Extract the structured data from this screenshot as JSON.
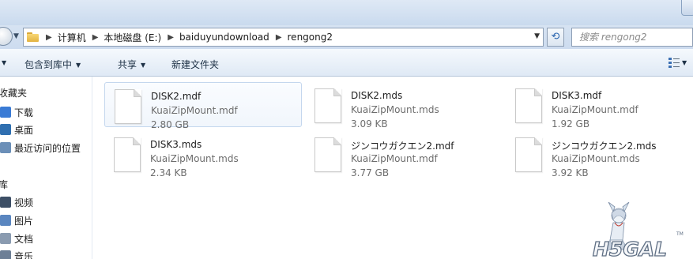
{
  "titlebar": {
    "ghost_title": ""
  },
  "address": {
    "crumbs": [
      "计算机",
      "本地磁盘 (E:)",
      "baiduyundownload",
      "rengong2"
    ],
    "search_placeholder": "搜索 rengong2"
  },
  "toolbar": {
    "include_library": "包含到库中",
    "share": "共享",
    "new_folder": "新建文件夹"
  },
  "sidebar": {
    "favorites_label": "收藏夹",
    "favorites": [
      {
        "label": "下载",
        "icon": "download-folder-icon",
        "color": "#3a7bd5"
      },
      {
        "label": "桌面",
        "icon": "desktop-icon",
        "color": "#2f6fb0"
      },
      {
        "label": "最近访问的位置",
        "icon": "recent-places-icon",
        "color": "#6b8fb8"
      }
    ],
    "libraries_label": "库",
    "libraries": [
      {
        "label": "视频",
        "icon": "video-library-icon",
        "color": "#3d4f66"
      },
      {
        "label": "图片",
        "icon": "pictures-library-icon",
        "color": "#5a86c0"
      },
      {
        "label": "文档",
        "icon": "documents-library-icon",
        "color": "#8a9bb0"
      },
      {
        "label": "音乐",
        "icon": "music-library-icon",
        "color": "#6d7f96"
      }
    ]
  },
  "files": [
    {
      "name": "DISK2.mdf",
      "type": "KuaiZipMount.mdf",
      "size": "2.80 GB",
      "selected": true
    },
    {
      "name": "DISK2.mds",
      "type": "KuaiZipMount.mds",
      "size": "3.09 KB",
      "selected": false
    },
    {
      "name": "DISK3.mdf",
      "type": "KuaiZipMount.mdf",
      "size": "1.92 GB",
      "selected": false
    },
    {
      "name": "DISK3.mds",
      "type": "KuaiZipMount.mds",
      "size": "2.34 KB",
      "selected": false
    },
    {
      "name": "ジンコウガクエン2.mdf",
      "type": "KuaiZipMount.mdf",
      "size": "3.77 GB",
      "selected": false
    },
    {
      "name": "ジンコウガクエン2.mds",
      "type": "KuaiZipMount.mds",
      "size": "3.92 KB",
      "selected": false
    }
  ],
  "watermark": {
    "text": "H5GAL",
    "tm": "TM"
  },
  "colors": {
    "accent": "#3c70b4",
    "selection_border": "#c4d7ee",
    "chrome": "#cddcef"
  }
}
